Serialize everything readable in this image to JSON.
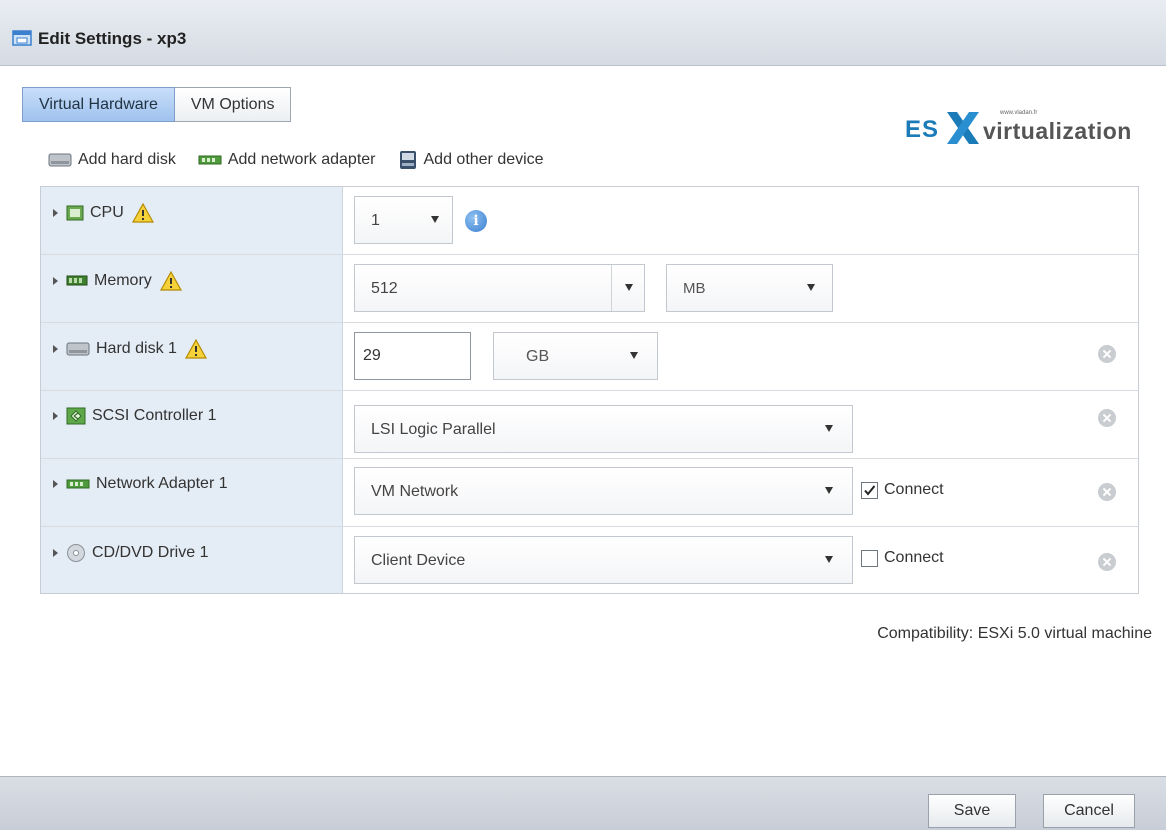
{
  "window": {
    "title": "Edit Settings - xp3"
  },
  "tabs": [
    {
      "label": "Virtual Hardware",
      "active": true
    },
    {
      "label": "VM Options",
      "active": false
    }
  ],
  "logo": {
    "part1": "ES",
    "part2": "virtualization",
    "small_text": "www.vladan.fr"
  },
  "toolbar": {
    "add_hard_disk": "Add hard disk",
    "add_network_adapter": "Add network adapter",
    "add_other_device": "Add other device"
  },
  "hardware": {
    "cpu": {
      "label": "CPU",
      "value": "1",
      "warning": true
    },
    "memory": {
      "label": "Memory",
      "value": "512",
      "unit": "MB",
      "warning": true
    },
    "hard_disk": {
      "label": "Hard disk 1",
      "value": "29",
      "unit": "GB",
      "warning": true
    },
    "scsi": {
      "label": "SCSI Controller 1",
      "value": "LSI Logic Parallel"
    },
    "network": {
      "label": "Network Adapter 1",
      "value": "VM Network",
      "connect_label": "Connect",
      "connected": true
    },
    "cdrom": {
      "label": "CD/DVD Drive 1",
      "value": "Client Device",
      "connect_label": "Connect",
      "connected": false
    }
  },
  "compatibility": "Compatibility: ESXi 5.0 virtual machine",
  "footer": {
    "save": "Save",
    "cancel": "Cancel"
  },
  "colors": {
    "tab_active": "#9fc2ee",
    "row_label_bg": "#e4ecf5",
    "logo_blue": "#1b7bb8"
  }
}
